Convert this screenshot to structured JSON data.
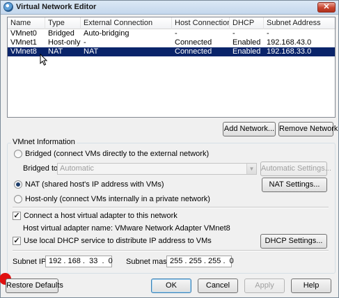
{
  "window": {
    "title": "Virtual Network Editor",
    "close_glyph": "✕",
    "icon": "network-globe-icon"
  },
  "table": {
    "columns": [
      "Name",
      "Type",
      "External Connection",
      "Host Connection",
      "DHCP",
      "Subnet Address"
    ],
    "rows": [
      {
        "name": "VMnet0",
        "type": "Bridged",
        "external": "Auto-bridging",
        "host": "-",
        "dhcp": "-",
        "subnet": "-"
      },
      {
        "name": "VMnet1",
        "type": "Host-only",
        "external": "-",
        "host": "Connected",
        "dhcp": "Enabled",
        "subnet": "192.168.43.0"
      },
      {
        "name": "VMnet8",
        "type": "NAT",
        "external": "NAT",
        "host": "Connected",
        "dhcp": "Enabled",
        "subnet": "192.168.33.0"
      }
    ],
    "selected_row": "VMnet8"
  },
  "buttons": {
    "add_network": "Add Network...",
    "remove_network": "Remove Network",
    "automatic_settings": "Automatic Settings...",
    "nat_settings": "NAT Settings...",
    "dhcp_settings": "DHCP Settings...",
    "restore_defaults": "Restore Defaults",
    "ok": "OK",
    "cancel": "Cancel",
    "apply": "Apply",
    "help": "Help"
  },
  "vmnet_info": {
    "legend": "VMnet Information",
    "bridged_label": "Bridged (connect VMs directly to the external network)",
    "bridged_to_label": "Bridged to:",
    "bridged_to_value": "Automatic",
    "nat_label": "NAT (shared host's IP address with VMs)",
    "hostonly_label": "Host-only (connect VMs internally in a private network)",
    "selected_mode": "NAT",
    "connect_adapter_label": "Connect a host virtual adapter to this network",
    "connect_adapter_checked": true,
    "adapter_name_text": "Host virtual adapter name: VMware Network Adapter VMnet8",
    "dhcp_label": "Use local DHCP service to distribute IP address to VMs",
    "dhcp_checked": true,
    "check_glyph": "✓",
    "combo_arrow_glyph": "▼"
  },
  "subnet": {
    "ip_label": "Subnet IP:",
    "ip_value": "192 . 168 .  33  .  0",
    "mask_label": "Subnet mask:",
    "mask_value": "255 . 255 . 255 .  0"
  },
  "colors": {
    "selection": "#0a246a",
    "window_bg": "#f0f0f0",
    "marker": "#e01010"
  }
}
